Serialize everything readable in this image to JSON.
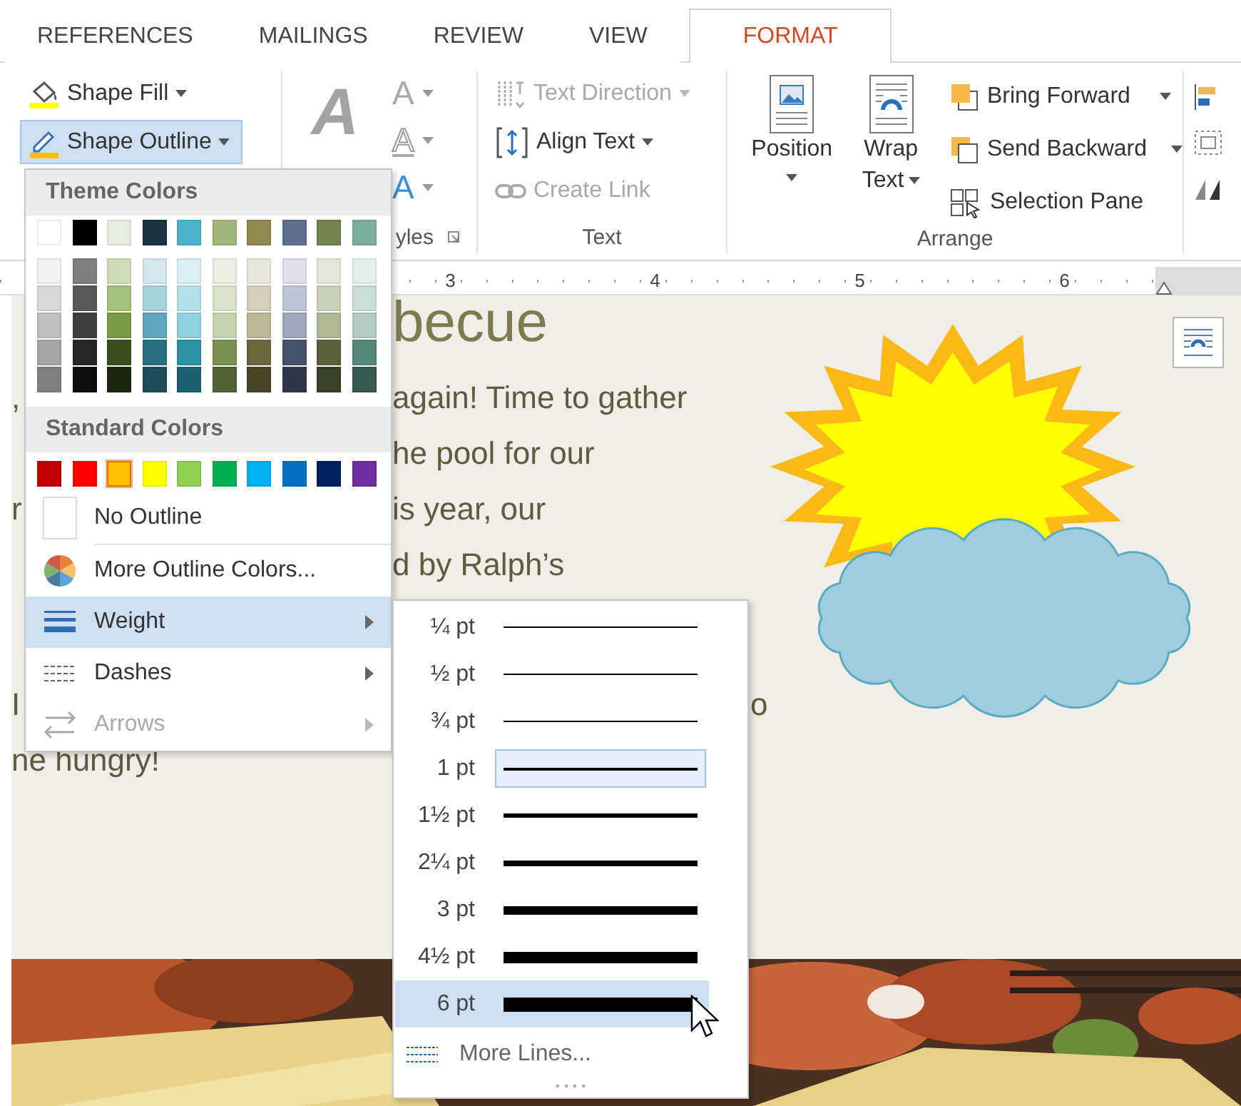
{
  "tabs": [
    {
      "label": "REFERENCES",
      "selected": false
    },
    {
      "label": "MAILINGS",
      "selected": false
    },
    {
      "label": "REVIEW",
      "selected": false
    },
    {
      "label": "VIEW",
      "selected": false
    },
    {
      "label": "FORMAT",
      "selected": true
    }
  ],
  "ribbon": {
    "shape_styles": {
      "buttons": [
        {
          "kind": "fill",
          "label": "Shape Fill",
          "selected": false
        },
        {
          "kind": "outline",
          "label": "Shape Outline",
          "selected": true
        }
      ]
    },
    "wordart": {
      "quick_glyph": "A",
      "glyphs": [
        {
          "kind": "fill",
          "glyph": "A"
        },
        {
          "kind": "outline",
          "glyph": "A"
        },
        {
          "kind": "effects",
          "glyph": "A"
        }
      ],
      "group_label": "yles"
    },
    "text_group": {
      "buttons": [
        {
          "kind": "text_direction",
          "label": "Text Direction",
          "disabled": true
        },
        {
          "kind": "align_text",
          "label": "Align Text",
          "disabled": false
        },
        {
          "kind": "link",
          "label": "Create Link",
          "disabled": true
        }
      ],
      "group_label": "Text"
    },
    "arrange": {
      "large_buttons": [
        {
          "kind": "position",
          "label": "Position"
        },
        {
          "kind": "wrap",
          "label": "Wrap Text"
        }
      ],
      "small_buttons": [
        {
          "kind": "bring_forward",
          "label": "Bring Forward"
        },
        {
          "kind": "send_backward",
          "label": "Send Backward"
        },
        {
          "kind": "selection_pane",
          "label": "Selection Pane"
        }
      ],
      "group_label": "Arrange"
    }
  },
  "ruler": {
    "numbers": [
      "3",
      "4",
      "5",
      "6"
    ]
  },
  "document": {
    "title": "becue",
    "lines": [
      {
        "kind": "line",
        "left": ",",
        "right": "again! Time to gather"
      },
      {
        "kind": "line",
        "right": "he pool for our"
      },
      {
        "kind": "line",
        "left": "r",
        "right": "is year, our"
      },
      {
        "kind": "line",
        "right": "d by Ralph’s"
      },
      {
        "kind": "line"
      },
      {
        "kind": "paragraph",
        "left": "I",
        "far": "o"
      },
      {
        "kind": "line",
        "left": "ne hungry!"
      }
    ]
  },
  "outline_menu": {
    "theme_header": "Theme Colors",
    "theme_colors": [
      {
        "color": "#ffffff",
        "shades": [
          {
            "color": "#f2f2f2"
          },
          {
            "color": "#d9d9d9"
          },
          {
            "color": "#bfbfbf"
          },
          {
            "color": "#a6a6a6"
          },
          {
            "color": "#808080"
          }
        ]
      },
      {
        "color": "#000000",
        "shades": [
          {
            "color": "#7f7f7f"
          },
          {
            "color": "#595959"
          },
          {
            "color": "#3f3f3f"
          },
          {
            "color": "#262626"
          },
          {
            "color": "#0d0d0d"
          }
        ]
      },
      {
        "color": "#e8ebe0",
        "shades": [
          {
            "color": "#cfdcb8"
          },
          {
            "color": "#a6c07f"
          },
          {
            "color": "#7a9a44"
          },
          {
            "color": "#3b4d20"
          },
          {
            "color": "#1b2510"
          }
        ]
      },
      {
        "color": "#1a343c",
        "shades": [
          {
            "color": "#d4e8ee"
          },
          {
            "color": "#a8d2dd"
          },
          {
            "color": "#5fa8bb"
          },
          {
            "color": "#2b6f80"
          },
          {
            "color": "#1e4c58"
          }
        ]
      },
      {
        "color": "#4bb3c9",
        "shades": [
          {
            "color": "#daeff4"
          },
          {
            "color": "#b6e0ea"
          },
          {
            "color": "#90d1df"
          },
          {
            "color": "#2f8fa4"
          },
          {
            "color": "#1f6070"
          }
        ]
      },
      {
        "color": "#a3b77c",
        "shades": [
          {
            "color": "#ecf0e4"
          },
          {
            "color": "#d9e2c9"
          },
          {
            "color": "#c7d3ae"
          },
          {
            "color": "#7a8f50"
          },
          {
            "color": "#526035"
          }
        ]
      },
      {
        "color": "#8f8a50",
        "shades": [
          {
            "color": "#e9e8dc"
          },
          {
            "color": "#d2d0b9"
          },
          {
            "color": "#bcb996"
          },
          {
            "color": "#6b673c"
          },
          {
            "color": "#474528"
          }
        ]
      },
      {
        "color": "#5e6e8e",
        "shades": [
          {
            "color": "#dfe2e8"
          },
          {
            "color": "#bfc5d2"
          },
          {
            "color": "#a0a8bb"
          },
          {
            "color": "#46526b"
          },
          {
            "color": "#2f3747"
          }
        ]
      },
      {
        "color": "#75834e",
        "shades": [
          {
            "color": "#e4e8dc"
          },
          {
            "color": "#cad1b8"
          },
          {
            "color": "#afba94"
          },
          {
            "color": "#58623a"
          },
          {
            "color": "#3a4127"
          }
        ]
      },
      {
        "color": "#7fae9c",
        "shades": [
          {
            "color": "#e5efeb"
          },
          {
            "color": "#cbded7"
          },
          {
            "color": "#b2cec3"
          },
          {
            "color": "#55887a"
          },
          {
            "color": "#385b51"
          }
        ]
      }
    ],
    "standard_header": "Standard Colors",
    "standard_colors": [
      {
        "color": "#c00000",
        "selected": false
      },
      {
        "color": "#ff0000",
        "selected": false
      },
      {
        "color": "#ffc000",
        "selected": true
      },
      {
        "color": "#ffff00",
        "selected": false
      },
      {
        "color": "#92d050",
        "selected": false
      },
      {
        "color": "#00b050",
        "selected": false
      },
      {
        "color": "#00b0f0",
        "selected": false
      },
      {
        "color": "#0070c0",
        "selected": false
      },
      {
        "color": "#002060",
        "selected": false
      },
      {
        "color": "#7030a0",
        "selected": false
      }
    ],
    "items": [
      {
        "kind": "no_outline",
        "label": "No Outline",
        "selected": false,
        "disabled": false,
        "submenu": false
      },
      {
        "kind": "more_colors",
        "label": "More Outline Colors...",
        "selected": false,
        "disabled": false,
        "submenu": false
      },
      {
        "kind": "weight",
        "label": "Weight",
        "selected": true,
        "disabled": false,
        "submenu": true
      },
      {
        "kind": "dashes",
        "label": "Dashes",
        "selected": false,
        "disabled": false,
        "submenu": true
      },
      {
        "kind": "arrows",
        "label": "Arrows",
        "selected": false,
        "disabled": true,
        "submenu": true
      }
    ]
  },
  "weight_menu": {
    "items": [
      {
        "label": "¼ pt",
        "current": false,
        "selected": false
      },
      {
        "label": "½ pt",
        "current": false,
        "selected": false
      },
      {
        "label": "¾ pt",
        "current": false,
        "selected": false
      },
      {
        "label": "1 pt",
        "current": true,
        "selected": false
      },
      {
        "label": "1½ pt",
        "current": false,
        "selected": false
      },
      {
        "label": "2¼ pt",
        "current": false,
        "selected": false
      },
      {
        "label": "3 pt",
        "current": false,
        "selected": false
      },
      {
        "label": "4½ pt",
        "current": false,
        "selected": false
      },
      {
        "label": "6 pt",
        "current": false,
        "selected": true
      }
    ],
    "more_label": "More Lines..."
  }
}
